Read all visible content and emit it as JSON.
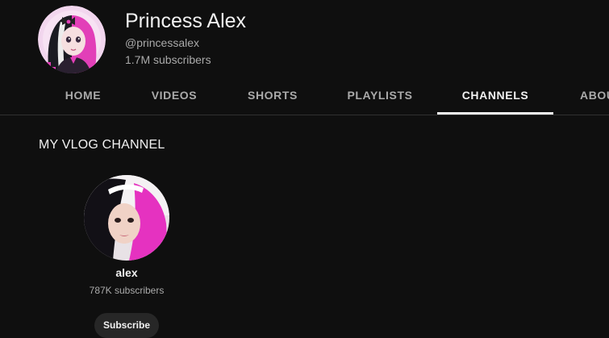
{
  "channel": {
    "title": "Princess Alex",
    "handle": "@princessalex",
    "subscribers": "1.7M subscribers",
    "avatar_icon": "channel-avatar"
  },
  "tabs": [
    {
      "label": "HOME",
      "active": false
    },
    {
      "label": "VIDEOS",
      "active": false
    },
    {
      "label": "SHORTS",
      "active": false
    },
    {
      "label": "PLAYLISTS",
      "active": false
    },
    {
      "label": "CHANNELS",
      "active": true
    },
    {
      "label": "ABOUT",
      "active": false
    }
  ],
  "section": {
    "title": "MY VLOG CHANNEL",
    "channels": [
      {
        "name": "alex",
        "subscribers": "787K subscribers",
        "subscribe_label": "Subscribe",
        "avatar_icon": "channel-avatar"
      }
    ]
  },
  "colors": {
    "background": "#0f0f0f",
    "text_primary": "#f1f1f1",
    "text_secondary": "#aaaaaa",
    "button_bg": "#272727",
    "accent_pink": "#e23fb8"
  }
}
